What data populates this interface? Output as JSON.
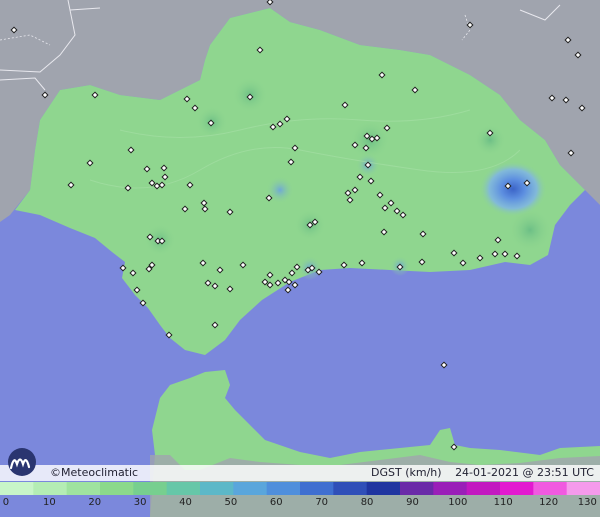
{
  "brand": {
    "name": "©Meteoclimatic"
  },
  "variable": "DGST (km/h)",
  "datetime": "24-01-2021 @ 23:51 UTC",
  "scale": {
    "ticks": [
      "0",
      "10",
      "20",
      "30",
      "40",
      "50",
      "60",
      "70",
      "80",
      "90",
      "100",
      "110",
      "120",
      "130"
    ],
    "colors": [
      "#c8f5c8",
      "#b4edb4",
      "#9fe39f",
      "#8bd98b",
      "#77cf8f",
      "#66c7a8",
      "#5cb8c8",
      "#5aa6dc",
      "#4f8fdc",
      "#3f6fd0",
      "#2f4fb8",
      "#1f35a0",
      "#6a2aa8",
      "#9a1fb8",
      "#c218c0",
      "#e21ad0",
      "#f05ae0",
      "#f59aec"
    ]
  },
  "colors": {
    "sea": "#7b88dc",
    "land_out": "#9fa3ad",
    "region": "#8fd68f"
  },
  "stations": [
    [
      14,
      30
    ],
    [
      45,
      95
    ],
    [
      95,
      95
    ],
    [
      260,
      50
    ],
    [
      270,
      2
    ],
    [
      382,
      75
    ],
    [
      415,
      90
    ],
    [
      470,
      25
    ],
    [
      568,
      40
    ],
    [
      578,
      55
    ],
    [
      552,
      98
    ],
    [
      566,
      100
    ],
    [
      582,
      108
    ],
    [
      571,
      153
    ],
    [
      250,
      97
    ],
    [
      211,
      123
    ],
    [
      195,
      108
    ],
    [
      187,
      99
    ],
    [
      345,
      105
    ],
    [
      367,
      136
    ],
    [
      372,
      139
    ],
    [
      387,
      128
    ],
    [
      490,
      133
    ],
    [
      355,
      145
    ],
    [
      368,
      165
    ],
    [
      295,
      148
    ],
    [
      291,
      162
    ],
    [
      280,
      124
    ],
    [
      287,
      119
    ],
    [
      273,
      127
    ],
    [
      366,
      148
    ],
    [
      377,
      138
    ],
    [
      147,
      169
    ],
    [
      152,
      183
    ],
    [
      157,
      186
    ],
    [
      162,
      185
    ],
    [
      165,
      177
    ],
    [
      164,
      168
    ],
    [
      90,
      163
    ],
    [
      71,
      185
    ],
    [
      131,
      150
    ],
    [
      128,
      188
    ],
    [
      190,
      185
    ],
    [
      230,
      212
    ],
    [
      204,
      203
    ],
    [
      205,
      209
    ],
    [
      185,
      209
    ],
    [
      269,
      198
    ],
    [
      310,
      225
    ],
    [
      315,
      222
    ],
    [
      360,
      177
    ],
    [
      371,
      181
    ],
    [
      380,
      195
    ],
    [
      385,
      208
    ],
    [
      391,
      203
    ],
    [
      397,
      211
    ],
    [
      403,
      215
    ],
    [
      384,
      232
    ],
    [
      348,
      193
    ],
    [
      355,
      190
    ],
    [
      350,
      200
    ],
    [
      423,
      234
    ],
    [
      508,
      186
    ],
    [
      527,
      183
    ],
    [
      498,
      240
    ],
    [
      495,
      254
    ],
    [
      505,
      254
    ],
    [
      517,
      256
    ],
    [
      454,
      253
    ],
    [
      463,
      263
    ],
    [
      480,
      258
    ],
    [
      422,
      262
    ],
    [
      400,
      267
    ],
    [
      362,
      263
    ],
    [
      344,
      265
    ],
    [
      297,
      267
    ],
    [
      308,
      270
    ],
    [
      312,
      268
    ],
    [
      319,
      272
    ],
    [
      292,
      273
    ],
    [
      285,
      280
    ],
    [
      295,
      285
    ],
    [
      288,
      290
    ],
    [
      270,
      275
    ],
    [
      265,
      282
    ],
    [
      243,
      265
    ],
    [
      220,
      270
    ],
    [
      203,
      263
    ],
    [
      208,
      283
    ],
    [
      215,
      286
    ],
    [
      230,
      289
    ],
    [
      215,
      325
    ],
    [
      150,
      237
    ],
    [
      158,
      241
    ],
    [
      162,
      241
    ],
    [
      123,
      268
    ],
    [
      133,
      273
    ],
    [
      152,
      265
    ],
    [
      149,
      269
    ],
    [
      137,
      290
    ],
    [
      143,
      303
    ],
    [
      169,
      335
    ],
    [
      270,
      285
    ],
    [
      278,
      283
    ],
    [
      289,
      282
    ],
    [
      444,
      365
    ],
    [
      454,
      447
    ]
  ]
}
